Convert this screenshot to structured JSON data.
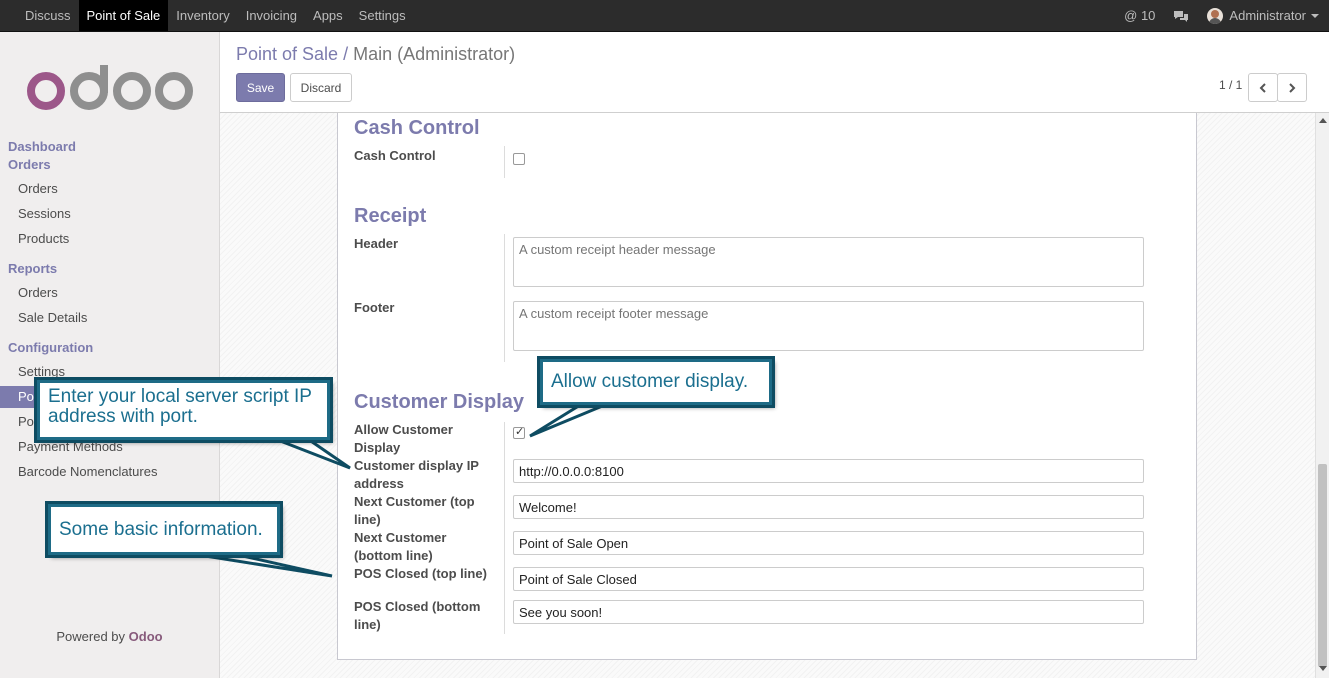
{
  "topbar": {
    "menu": [
      "Discuss",
      "Point of Sale",
      "Inventory",
      "Invoicing",
      "Apps",
      "Settings"
    ],
    "active_index": 1,
    "mentions_count": "@ 10",
    "user": "Administrator"
  },
  "sidebar": {
    "dashboard": "Dashboard",
    "orders_section": "Orders",
    "orders_items": [
      "Orders",
      "Sessions",
      "Products"
    ],
    "reports_section": "Reports",
    "reports_items": [
      "Orders",
      "Sale Details"
    ],
    "config_section": "Configuration",
    "config_items": [
      "Settings",
      "Po",
      "Po",
      "Payment Methods",
      "Barcode Nomenclatures"
    ],
    "powered_prefix": "Powered by",
    "powered_brand": "Odoo"
  },
  "control_panel": {
    "breadcrumb_root": "Point of Sale /",
    "breadcrumb_current": "Main (Administrator)",
    "save_label": "Save",
    "discard_label": "Discard",
    "pager": "1 / 1"
  },
  "form": {
    "cash_control_title": "Cash Control",
    "cash_control_label": "Cash Control",
    "cash_control_checked": false,
    "receipt_title": "Receipt",
    "header_label": "Header",
    "header_placeholder": "A custom receipt header message",
    "footer_label": "Footer",
    "footer_placeholder": "A custom receipt footer message",
    "customer_display_title": "Customer Display",
    "allow_customer_display_label": "Allow Customer Display",
    "allow_customer_display_checked": true,
    "ip_label": "Customer display IP address",
    "ip_value": "http://0.0.0.0:8100",
    "next_top_label": "Next Customer (top line)",
    "next_top_value": "Welcome!",
    "next_bottom_label": "Next Customer (bottom line)",
    "next_bottom_value": "Point of Sale Open",
    "closed_top_label": "POS Closed (top line)",
    "closed_top_value": "Point of Sale Closed",
    "closed_bottom_label": "POS Closed (bottom line)",
    "closed_bottom_value": "See you soon!"
  },
  "callouts": {
    "allow_display": "Allow customer display.",
    "ip_address": "Enter your local server script IP address with port.",
    "basic_info": "Some basic information."
  },
  "colors": {
    "brand": "#7c7bad",
    "callout_border": "#1e6b86",
    "callout_text": "#1b6f8f"
  }
}
